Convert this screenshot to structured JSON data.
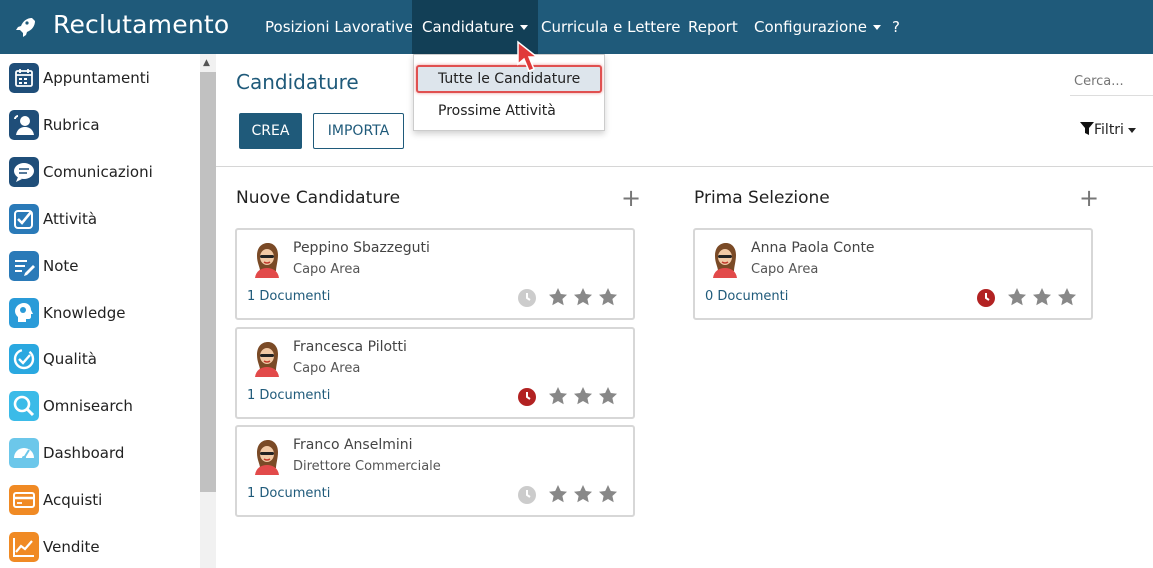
{
  "app": {
    "title": "Reclutamento"
  },
  "nav": {
    "items": [
      {
        "label": "Posizioni Lavorative"
      },
      {
        "label": "Candidature"
      },
      {
        "label": "Curricula e Lettere"
      },
      {
        "label": "Report"
      },
      {
        "label": "Configurazione"
      },
      {
        "label": "?"
      }
    ]
  },
  "dropdown": {
    "items": [
      {
        "label": "Tutte le Candidature"
      },
      {
        "label": "Prossime Attività"
      }
    ]
  },
  "sidebar": {
    "items": [
      {
        "label": "Appuntamenti",
        "icon": "calendar-icon",
        "color": "#1f4e79"
      },
      {
        "label": "Rubrica",
        "icon": "contacts-icon",
        "color": "#1f4e79"
      },
      {
        "label": "Comunicazioni",
        "icon": "chat-icon",
        "color": "#1f4e79"
      },
      {
        "label": "Attività",
        "icon": "checkbox-icon",
        "color": "#2a7ab8"
      },
      {
        "label": "Note",
        "icon": "note-icon",
        "color": "#2a7ab8"
      },
      {
        "label": "Knowledge",
        "icon": "knowledge-icon",
        "color": "#2a9bd8"
      },
      {
        "label": "Qualità",
        "icon": "quality-icon",
        "color": "#2aa8e0"
      },
      {
        "label": "Omnisearch",
        "icon": "search-icon",
        "color": "#3bbbe8"
      },
      {
        "label": "Dashboard",
        "icon": "dashboard-icon",
        "color": "#6cc7ea"
      },
      {
        "label": "Acquisti",
        "icon": "card-icon",
        "color": "#f08a24"
      },
      {
        "label": "Vendite",
        "icon": "chart-icon",
        "color": "#f08a24"
      }
    ]
  },
  "main": {
    "title": "Candidature",
    "create_label": "CREA",
    "import_label": "IMPORTA",
    "search_placeholder": "Cerca...",
    "filter_label": "Filtri"
  },
  "columns": [
    {
      "title": "Nuove Candidature",
      "add": "+",
      "cards": [
        {
          "name": "Peppino Sbazzeguti",
          "role": "Capo Area",
          "docs": "1 Documenti",
          "overdue": false,
          "stars": 0
        },
        {
          "name": "Francesca Pilotti",
          "role": "Capo Area",
          "docs": "1 Documenti",
          "overdue": true,
          "stars": 0
        },
        {
          "name": "Franco Anselmini",
          "role": "Direttore Commerciale",
          "docs": "1 Documenti",
          "overdue": false,
          "stars": 0
        }
      ]
    },
    {
      "title": "Prima Selezione",
      "add": "+",
      "cards": [
        {
          "name": "Anna Paola Conte",
          "role": "Capo Area",
          "docs": "0 Documenti",
          "overdue": true,
          "stars": 0
        }
      ]
    }
  ],
  "colors": {
    "brand": "#1f5a7a",
    "overdue": "#b22222",
    "neutral_clock": "#cccccc",
    "star": "#888888",
    "highlight": "#e05050"
  }
}
